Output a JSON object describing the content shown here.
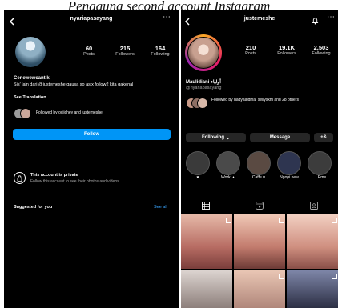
{
  "caption": "Pengguna second account Instagram",
  "left": {
    "username": "nyariapasayang",
    "stats": [
      {
        "value": "60",
        "label": "Posts"
      },
      {
        "value": "215",
        "label": "Followers"
      },
      {
        "value": "164",
        "label": "Following"
      }
    ],
    "display_name": "Cenewewcantik",
    "bio": "Sis' lain dari @justemeshe  gausa so asix follow2 kita gakenal",
    "see_translation": "See Translation",
    "followed_by": "Followed by ociichey and justemeshe",
    "follow_label": "Follow",
    "private_title": "This account is private",
    "private_subtitle": "Follow this account to see their photos and videos.",
    "suggested_label": "Suggested for you",
    "see_all": "See all",
    "accent": "#0095f6"
  },
  "right": {
    "username": "justemeshe",
    "stats": [
      {
        "value": "210",
        "label": "Posts"
      },
      {
        "value": "19.1K",
        "label": "Followers"
      },
      {
        "value": "2,503",
        "label": "Following"
      }
    ],
    "display_name": "Maulidiani أولياء",
    "handle": "@nyariapasayang",
    "followed_by": "Followed by nadyaaidina, sellyskm and 28 others",
    "following_label": "Following",
    "message_label": "Message",
    "add_person_label": "+&",
    "highlights": [
      {
        "label": "♥"
      },
      {
        "label": "Work ▲"
      },
      {
        "label": "Caffe ♥"
      },
      {
        "label": "Ngopi new"
      },
      {
        "label": "Eme"
      }
    ]
  }
}
